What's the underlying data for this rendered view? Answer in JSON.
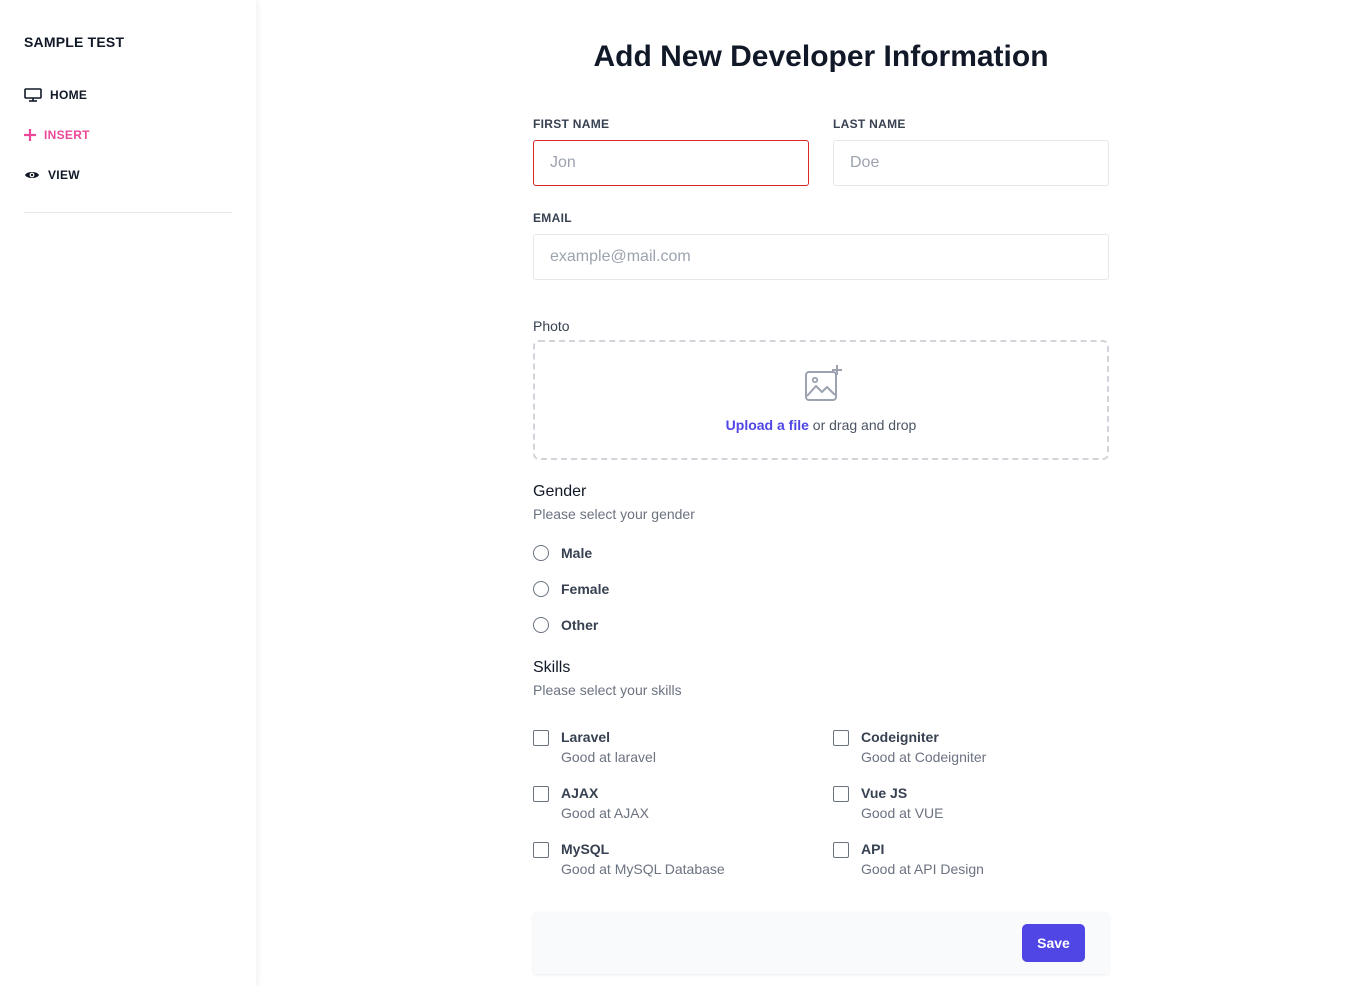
{
  "sidebar": {
    "brand": "SAMPLE TEST",
    "items": [
      {
        "label": "HOME",
        "icon": "monitor-icon"
      },
      {
        "label": "INSERT",
        "icon": "plus-icon",
        "active": true
      },
      {
        "label": "VIEW",
        "icon": "eye-icon"
      }
    ],
    "active_color": "#ec4899"
  },
  "main": {
    "title": "Add New Developer Information",
    "first_name": {
      "label": "FIRST NAME",
      "placeholder": "Jon",
      "value": ""
    },
    "last_name": {
      "label": "LAST NAME",
      "placeholder": "Doe",
      "value": ""
    },
    "email": {
      "label": "EMAIL",
      "placeholder": "example@mail.com",
      "value": ""
    },
    "photo": {
      "label": "Photo",
      "upload_link": "Upload a file",
      "upload_rest": " or drag and drop",
      "icon": "image-plus-icon"
    },
    "gender": {
      "title": "Gender",
      "subtitle": "Please select your gender",
      "options": [
        "Male",
        "Female",
        "Other"
      ]
    },
    "skills": {
      "title": "Skills",
      "subtitle": "Please select your skills",
      "items": [
        {
          "name": "Laravel",
          "desc": "Good at laravel"
        },
        {
          "name": "Codeigniter",
          "desc": "Good at Codeigniter"
        },
        {
          "name": "AJAX",
          "desc": "Good at AJAX"
        },
        {
          "name": "Vue JS",
          "desc": "Good at VUE"
        },
        {
          "name": "MySQL",
          "desc": "Good at MySQL Database"
        },
        {
          "name": "API",
          "desc": "Good at API Design"
        }
      ]
    },
    "save_label": "Save",
    "accent_color": "#4f46e5",
    "error_color": "#dc2626"
  }
}
